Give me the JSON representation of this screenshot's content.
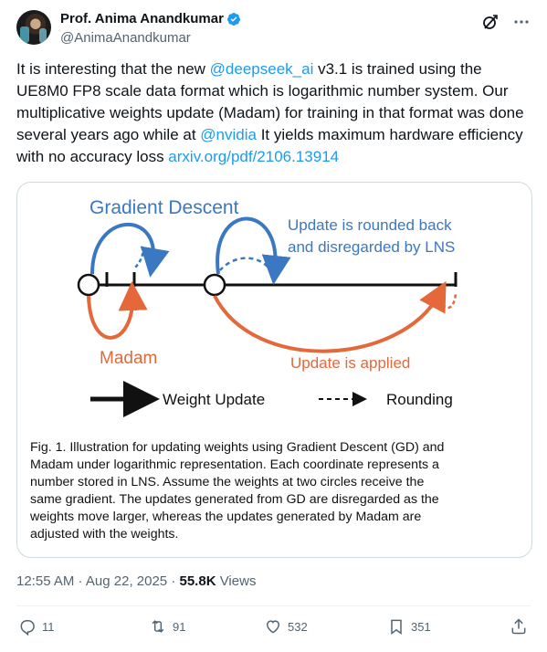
{
  "author": {
    "name": "Prof. Anima Anandkumar",
    "handle": "@AnimaAnandkumar"
  },
  "tweet": {
    "text_part1": "It is interesting that the new ",
    "mention1": "@deepseek_ai",
    "text_part2": " v3.1 is trained using the UE8M0 FP8 scale data format which is logarithmic number system. Our multiplicative weights update (Madam) for training in that format was done several years ago while at ",
    "mention2": "@nvidia",
    "text_part3": " It yields maximum hardware efficiency with no accuracy loss ",
    "link": "arxiv.org/pdf/2106.13914"
  },
  "figure": {
    "gd_label": "Gradient Descent",
    "gd_note_line1": "Update is rounded back",
    "gd_note_line2": "and disregarded by LNS",
    "madam_label": "Madam",
    "madam_note": "Update is applied",
    "legend_weight": "Weight Update",
    "legend_rounding": "Rounding",
    "caption_lines": [
      "Fig. 1. Illustration for updating weights using Gradient Descent (GD) and",
      "Madam under logarithmic representation. Each coordinate represents a",
      "number stored in LNS. Assume the weights at two circles receive the",
      "same gradient. The updates generated from GD are disregarded as the",
      "weights move larger, whereas the updates generated by Madam are",
      "adjusted with the weights."
    ]
  },
  "meta": {
    "time": "12:55 AM",
    "sep": " · ",
    "date": "Aug 22, 2025",
    "sep2": " · ",
    "views_count": "55.8K",
    "views_label": " Views"
  },
  "actions": {
    "replies": "11",
    "reposts": "91",
    "likes": "532",
    "bookmarks": "351"
  },
  "colors": {
    "blue": "#3a78c2",
    "orange": "#e4683a",
    "link": "#1d9bf0"
  }
}
